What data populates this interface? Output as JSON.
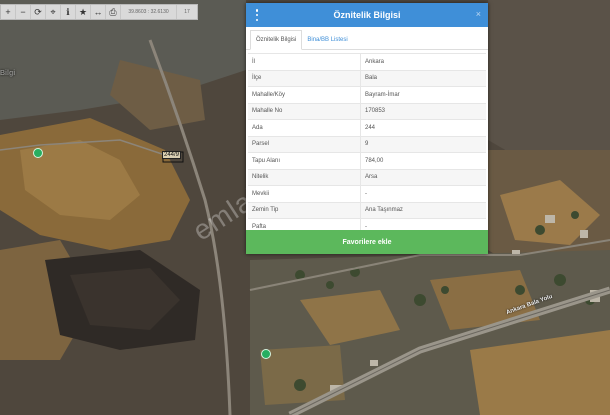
{
  "toolbar": {
    "buttons": [
      {
        "name": "zoom-in-icon",
        "glyph": "+"
      },
      {
        "name": "zoom-out-icon",
        "glyph": "−"
      },
      {
        "name": "refresh-icon",
        "glyph": "⟳"
      },
      {
        "name": "locate-icon",
        "glyph": "⌖"
      },
      {
        "name": "info-icon",
        "glyph": "ℹ"
      },
      {
        "name": "star-icon",
        "glyph": "★"
      },
      {
        "name": "measure-icon",
        "glyph": "↔"
      },
      {
        "name": "print-icon",
        "glyph": "⎙"
      }
    ],
    "coords": "39.8603 : 32.6130",
    "zoom": "17"
  },
  "panel": {
    "title": "Öznitelik Bilgisi",
    "close_glyph": "×",
    "tabs": [
      {
        "label": "Öznitelik Bilgisi",
        "active": true
      },
      {
        "label": "Bina/BB Listesi",
        "active": false
      }
    ],
    "rows": [
      {
        "key": "İl",
        "value": "Ankara"
      },
      {
        "key": "İlçe",
        "value": "Bala"
      },
      {
        "key": "Mahalle/Köy",
        "value": "Bayram-İmar"
      },
      {
        "key": "Mahalle No",
        "value": "170853"
      },
      {
        "key": "Ada",
        "value": "244"
      },
      {
        "key": "Parsel",
        "value": "9"
      },
      {
        "key": "Tapu Alanı",
        "value": "784,00"
      },
      {
        "key": "Nitelik",
        "value": "Arsa"
      },
      {
        "key": "Mevkii",
        "value": "-"
      },
      {
        "key": "Zemin Tip",
        "value": "Ana Taşınmaz"
      },
      {
        "key": "Pafta",
        "value": "-"
      }
    ],
    "favorite_label": "Favorilere ekle"
  },
  "map": {
    "labels": {
      "bilgi": "Bilgi",
      "parcel": "244/9",
      "road": "Ankara Bala Yolu"
    },
    "watermark": "emlakjet.com",
    "colors": {
      "header": "#3f8fd8",
      "button": "#5cb85c",
      "pin": "#27ae60"
    }
  }
}
